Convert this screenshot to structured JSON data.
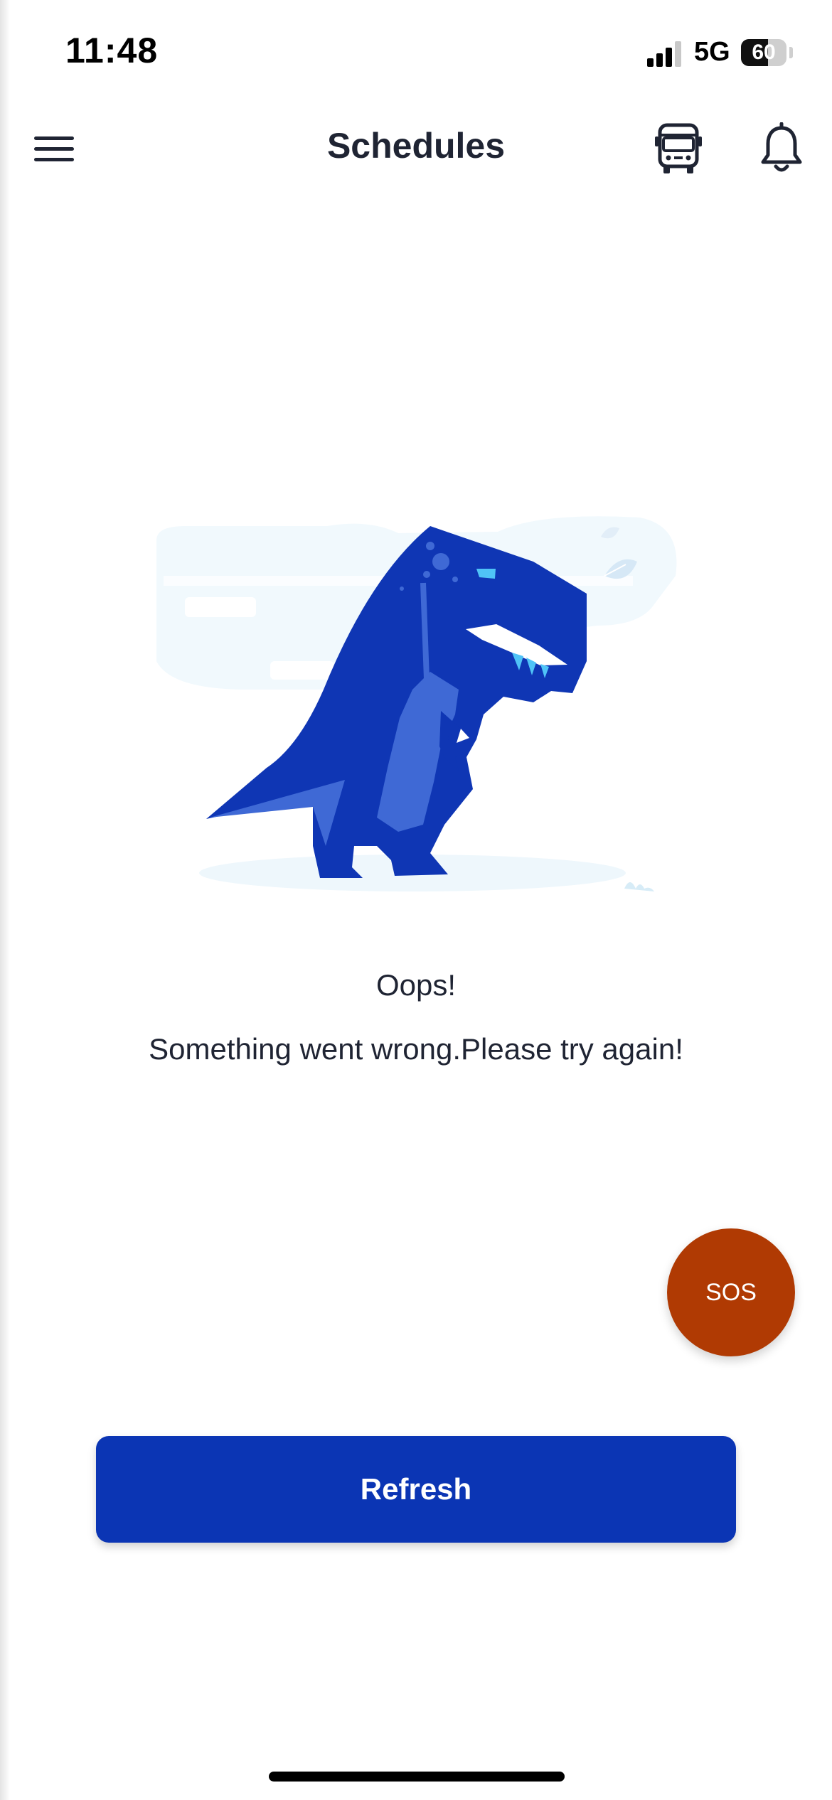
{
  "status_bar": {
    "time": "11:48",
    "network": "5G",
    "battery_level": "60",
    "battery_fraction": 0.6
  },
  "header": {
    "title": "Schedules",
    "menu_icon": "hamburger-menu-icon",
    "bus_icon": "bus-icon",
    "bell_icon": "bell-icon"
  },
  "error_state": {
    "illustration": "dinosaur-illustration",
    "heading": "Oops!",
    "message": "Something went wrong.Please try again!"
  },
  "sos_button": {
    "label": "SOS",
    "color": "#b03a03"
  },
  "refresh_button": {
    "label": "Refresh",
    "color": "#0b35b4"
  }
}
